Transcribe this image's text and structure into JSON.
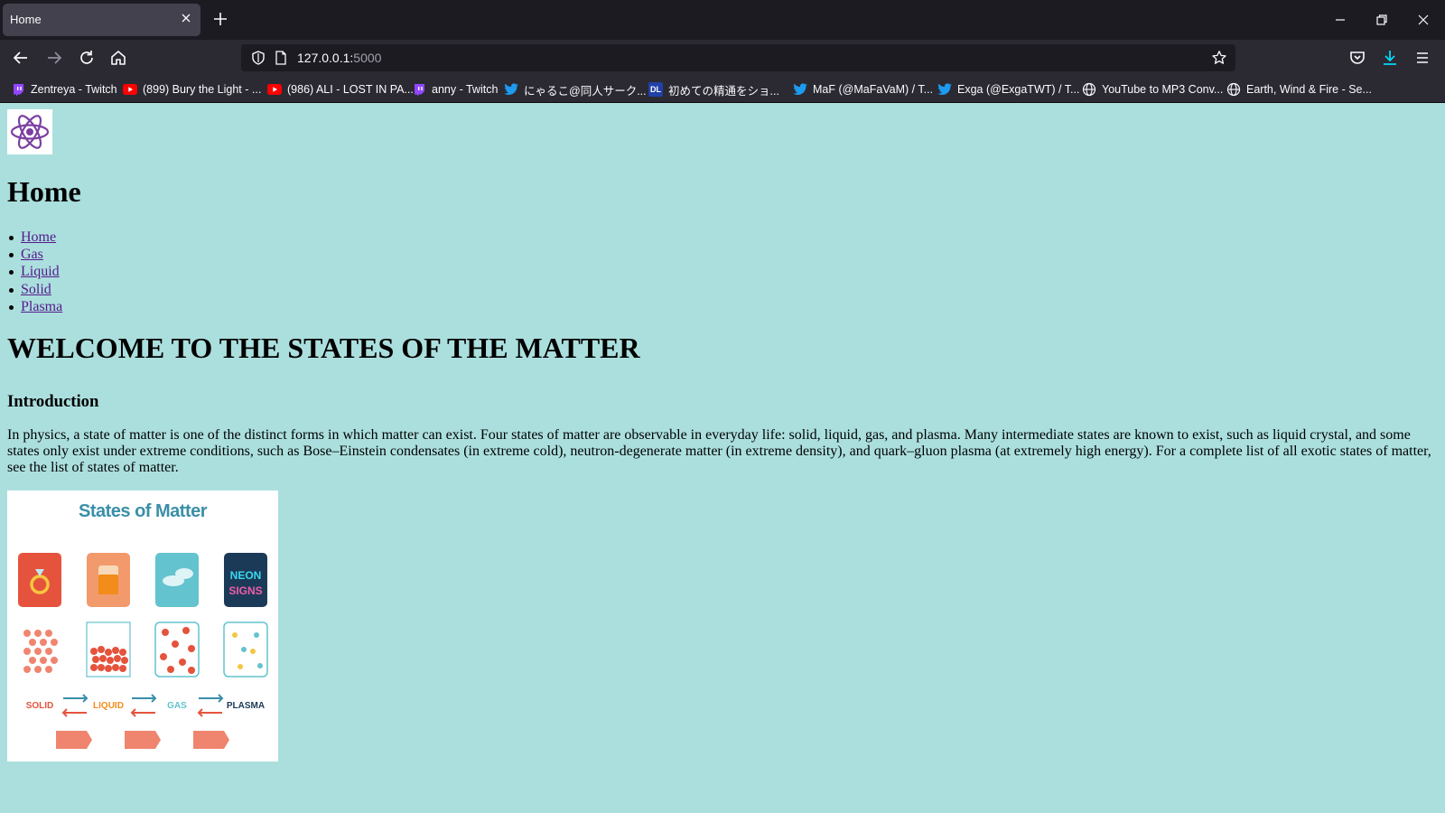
{
  "browser": {
    "tab": {
      "title": "Home"
    },
    "url": {
      "host": "127.0.0.1:",
      "port": "5000"
    },
    "bookmarks": [
      {
        "label": "Zentreya - Twitch",
        "icon": "twitch-icon"
      },
      {
        "label": "(899) Bury the Light - ...",
        "icon": "youtube-icon"
      },
      {
        "label": "(986) ALI - LOST IN PA...",
        "icon": "youtube-icon"
      },
      {
        "label": "anny - Twitch",
        "icon": "twitch-icon"
      },
      {
        "label": "にゃるこ@同人サーク...",
        "icon": "twitter-icon"
      },
      {
        "label": "初めての精通をショ...",
        "icon": "dlsite-icon",
        "icon_text": "DL"
      },
      {
        "label": "MaF (@MaFaVaM) / T...",
        "icon": "twitter-icon"
      },
      {
        "label": "Exga (@ExgaTWT) / T...",
        "icon": "twitter-icon"
      },
      {
        "label": "YouTube to MP3 Conv...",
        "icon": "globe-icon"
      },
      {
        "label": "Earth, Wind & Fire - Se...",
        "icon": "globe-icon"
      }
    ]
  },
  "page": {
    "heading": "Home",
    "nav": [
      "Home",
      "Gas",
      "Liquid",
      "Solid",
      "Plasma"
    ],
    "welcome": "WELCOME TO THE STATES OF THE MATTER",
    "intro_heading": "Introduction",
    "intro_text": "In physics, a state of matter is one of the distinct forms in which matter can exist. Four states of matter are observable in everyday life: solid, liquid, gas, and plasma. Many intermediate states are known to exist, such as liquid crystal, and some states only exist under extreme conditions, such as Bose–Einstein condensates (in extreme cold), neutron-degenerate matter (in extreme density), and quark–gluon plasma (at extremely high energy). For a complete list of all exotic states of matter, see the list of states of matter.",
    "image": {
      "title": "States of Matter",
      "labels": [
        "SOLID",
        "LIQUID",
        "GAS",
        "PLASMA"
      ],
      "neon_text": [
        "NEON",
        "SIGNS"
      ]
    }
  },
  "colors": {
    "page_bg": "#abdfde",
    "link": "#551a8b",
    "chrome_dark": "#1c1b22",
    "chrome": "#2b2a33",
    "logo_purple": "#7b3fa0"
  }
}
